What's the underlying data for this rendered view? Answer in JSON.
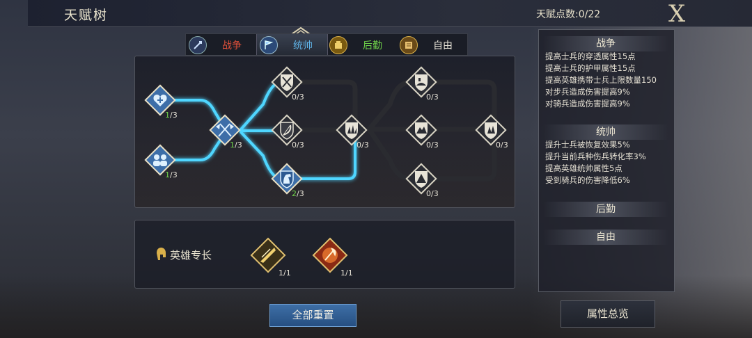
{
  "header": {
    "title": "天赋树",
    "points_label": "天赋点数:0/22",
    "close_label": "X"
  },
  "tabs": [
    {
      "label": "战争",
      "icon": "war-icon",
      "color": "#e0503a"
    },
    {
      "label": "统帅",
      "icon": "command-flag-icon",
      "color": "#5fb4e8"
    },
    {
      "label": "后勤",
      "icon": "logistics-icon",
      "color": "#6fd24a"
    },
    {
      "label": "自由",
      "icon": "freedom-scroll-icon",
      "color": "#e8e4d8"
    }
  ],
  "tree": {
    "nodes": [
      {
        "id": "heal",
        "icon": "heart-heal-icon",
        "current": "1",
        "max": "/3",
        "active": true
      },
      {
        "id": "troops",
        "icon": "soldiers-icon",
        "current": "1",
        "max": "/3",
        "active": true
      },
      {
        "id": "flags",
        "icon": "crossed-flags-icon",
        "current": "1",
        "max": "/3",
        "active": true
      },
      {
        "id": "swords",
        "icon": "crossed-swords-icon",
        "current": "0",
        "max": "/3",
        "active": false
      },
      {
        "id": "bow",
        "icon": "bow-icon",
        "current": "0",
        "max": "/3",
        "active": false
      },
      {
        "id": "horse",
        "icon": "horse-icon",
        "current": "2",
        "max": "/3",
        "active": true
      },
      {
        "id": "grass",
        "icon": "grass-icon",
        "current": "0",
        "max": "/3",
        "active": false
      },
      {
        "id": "hill",
        "icon": "hill-fort-icon",
        "current": "0",
        "max": "/3",
        "active": false
      },
      {
        "id": "mountain",
        "icon": "mountain-icon",
        "current": "0",
        "max": "/3",
        "active": false
      },
      {
        "id": "peak",
        "icon": "peak-icon",
        "current": "0",
        "max": "/3",
        "active": false
      },
      {
        "id": "forest",
        "icon": "forest-icon",
        "current": "0",
        "max": "/3",
        "active": false
      }
    ]
  },
  "specialty": {
    "label": "英雄专长",
    "items": [
      {
        "icon": "blade-strike-icon",
        "value": "1/1"
      },
      {
        "icon": "axe-rider-icon",
        "value": "1/1"
      }
    ]
  },
  "side": {
    "war_title": "战争",
    "war_lines": [
      "提高士兵的穿透属性15点",
      "提高士兵的护甲属性15点",
      "提高英雄携带士兵上限数量150",
      "对步兵造成伤害提高9%",
      "对骑兵造成伤害提高9%"
    ],
    "command_title": "统帅",
    "command_lines": [
      "提升士兵被恢复效果5%",
      "提升当前兵种伤兵转化率3%",
      "提高英雄统帅属性5点",
      "受到骑兵的伤害降低6%"
    ],
    "logistics_title": "后勤",
    "freedom_title": "自由"
  },
  "buttons": {
    "reset": "全部重置",
    "overview": "属性总览"
  }
}
